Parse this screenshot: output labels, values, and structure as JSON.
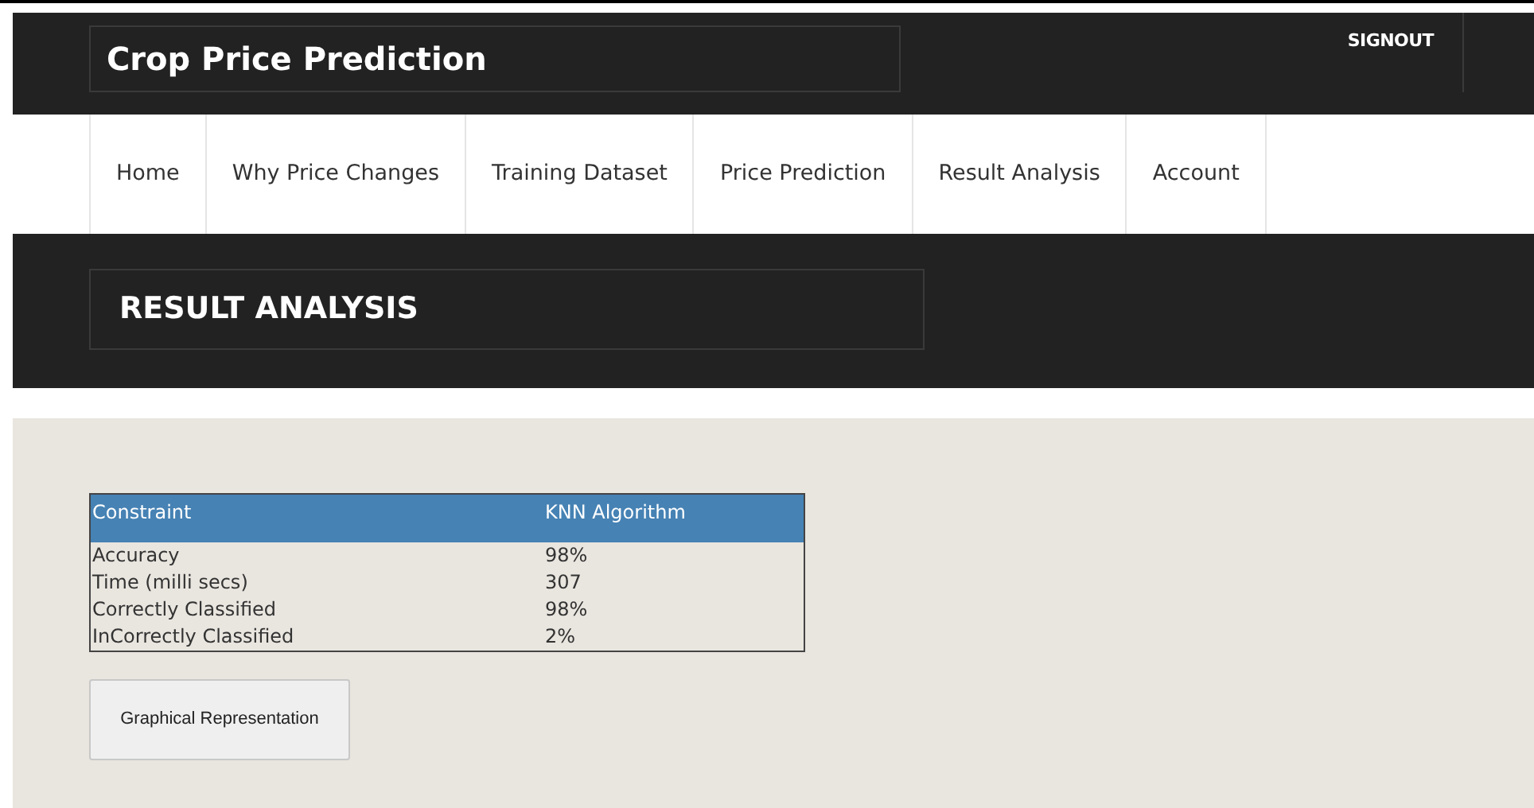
{
  "header": {
    "title": "Crop Price Prediction",
    "signout": "SIGNOUT"
  },
  "nav": [
    "Home",
    "Why Price Changes",
    "Training Dataset",
    "Price Prediction",
    "Result Analysis",
    "Account"
  ],
  "page_title": "RESULT ANALYSIS",
  "table": {
    "columns": [
      "Constraint",
      "KNN Algorithm"
    ],
    "rows": [
      [
        "Accuracy",
        "98%"
      ],
      [
        "Time (milli secs)",
        "307"
      ],
      [
        "Correctly Classified",
        "98%"
      ],
      [
        "InCorrectly Classified",
        "2%"
      ]
    ]
  },
  "button": "Graphical Representation"
}
